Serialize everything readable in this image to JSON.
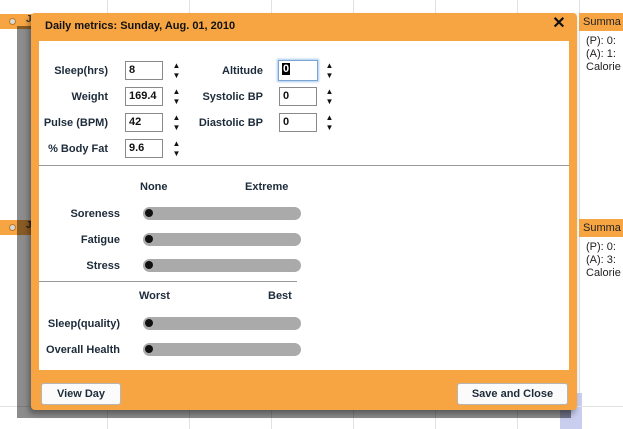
{
  "background": {
    "bar_letters": [
      "J",
      "J"
    ],
    "summary_panels": [
      {
        "header": "Summa",
        "lines": [
          "(P): 0:",
          "(A): 1:",
          "Calorie"
        ]
      },
      {
        "header": "Summa",
        "lines": [
          "(P): 0:",
          "(A): 3:",
          "Calorie"
        ]
      }
    ]
  },
  "dialog": {
    "title": "Daily metrics: Sunday, Aug. 01, 2010",
    "close_glyph": "✕",
    "metrics_left": [
      {
        "label": "Sleep(hrs)",
        "value": "8"
      },
      {
        "label": "Weight",
        "value": "169.4"
      },
      {
        "label": "Pulse (BPM)",
        "value": "42"
      },
      {
        "label": "% Body Fat",
        "value": "9.6"
      }
    ],
    "metrics_right": [
      {
        "label": "Altitude",
        "value": "0"
      },
      {
        "label": "Systolic BP",
        "value": "0"
      },
      {
        "label": "Diastolic BP",
        "value": "0"
      }
    ],
    "scale1": {
      "low": "None",
      "high": "Extreme",
      "rows": [
        {
          "label": "Soreness",
          "level": 0
        },
        {
          "label": "Fatigue",
          "level": 0
        },
        {
          "label": "Stress",
          "level": 0
        }
      ]
    },
    "scale2": {
      "low": "Worst",
      "high": "Best",
      "rows": [
        {
          "label": "Sleep(quality)",
          "level": 0
        },
        {
          "label": "Overall Health",
          "level": 0
        }
      ]
    },
    "buttons": {
      "view_day": "View Day",
      "save_close": "Save and Close"
    },
    "spinner_up": "▲",
    "spinner_down": "▼"
  },
  "colors": {
    "accent": "#f7a543",
    "slider_track": "#aaaaaa"
  }
}
